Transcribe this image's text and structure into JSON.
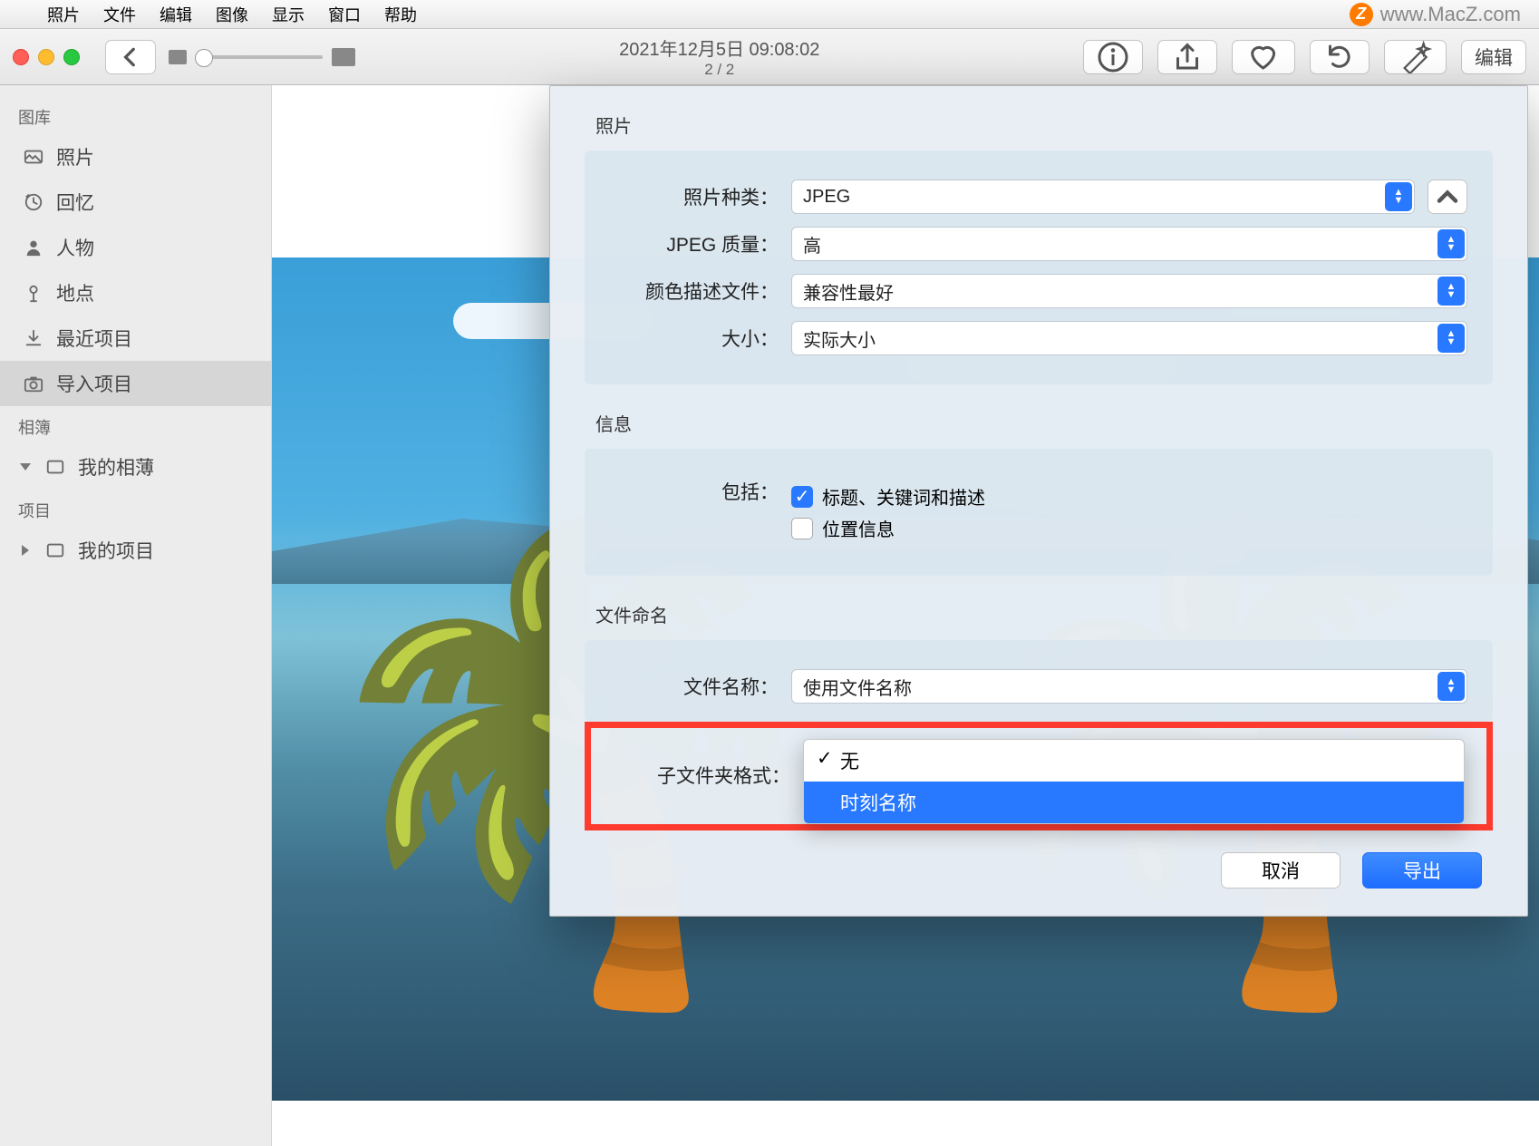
{
  "menubar": {
    "items": [
      "照片",
      "文件",
      "编辑",
      "图像",
      "显示",
      "窗口",
      "帮助"
    ],
    "watermark": "www.MacZ.com"
  },
  "toolbar": {
    "title": "2021年12月5日 09:08:02",
    "subtitle": "2 / 2",
    "edit_label": "编辑"
  },
  "sidebar": {
    "section_library": "图库",
    "items": [
      {
        "label": "照片"
      },
      {
        "label": "回忆"
      },
      {
        "label": "人物"
      },
      {
        "label": "地点"
      },
      {
        "label": "最近项目"
      },
      {
        "label": "导入项目"
      }
    ],
    "section_albums": "相簿",
    "my_album": "我的相薄",
    "section_projects": "项目",
    "my_project": "我的项目"
  },
  "dialog": {
    "section_photo": "照片",
    "photo_type_label": "照片种类：",
    "photo_type_value": "JPEG",
    "jpeg_quality_label": "JPEG 质量：",
    "jpeg_quality_value": "高",
    "color_profile_label": "颜色描述文件：",
    "color_profile_value": "兼容性最好",
    "size_label": "大小：",
    "size_value": "实际大小",
    "section_info": "信息",
    "include_label": "包括：",
    "cb_title": "标题、关键词和描述",
    "cb_location": "位置信息",
    "section_filename": "文件命名",
    "filename_label": "文件名称：",
    "filename_value": "使用文件名称",
    "subfolder_label": "子文件夹格式：",
    "subfolder_options": [
      "无",
      "时刻名称"
    ],
    "cancel": "取消",
    "export": "导出"
  }
}
